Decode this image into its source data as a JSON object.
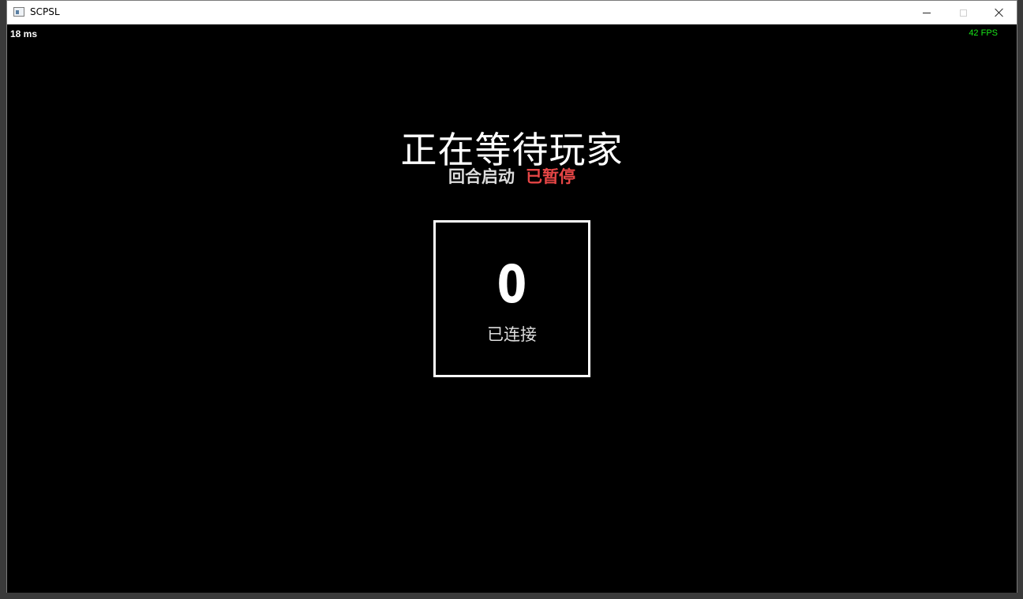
{
  "window": {
    "title": "SCPSL",
    "icon": "app-window-icon"
  },
  "hud": {
    "ping": "18 ms",
    "fps": "42 FPS",
    "fps_color": "#19e519"
  },
  "lobby": {
    "heading": "正在等待玩家",
    "round_label": "回合启动",
    "round_status": "已暂停",
    "round_status_color": "#e64646",
    "player_count": "0",
    "player_count_label": "已连接"
  }
}
